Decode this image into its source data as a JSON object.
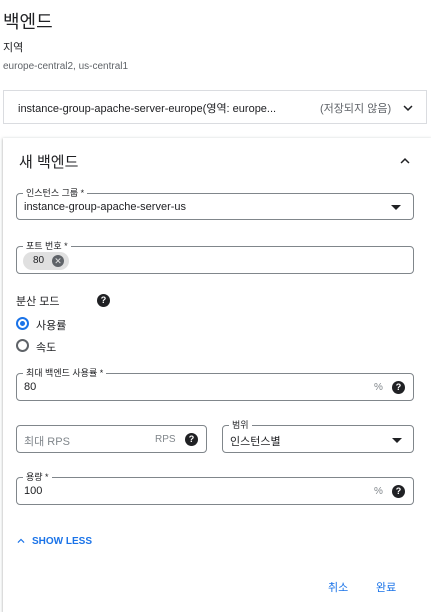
{
  "section": {
    "title": "백엔드",
    "region_label": "지역",
    "region_value": "europe-central2, us-central1"
  },
  "collapsed_backend": {
    "name": "instance-group-apache-server-europe(영역: europe...",
    "status": "(저장되지 않음)",
    "icon": "chevron-down-icon"
  },
  "new_backend": {
    "title": "새 백엔드",
    "icon": "chevron-up-icon",
    "instance_group": {
      "label": "인스턴스 그룹 *",
      "value": "instance-group-apache-server-us"
    },
    "port_numbers": {
      "label": "포트 번호 *",
      "chip_value": "80"
    },
    "balancing_mode": {
      "label": "분산 모드",
      "options": [
        {
          "label": "사용률",
          "selected": true
        },
        {
          "label": "속도",
          "selected": false
        }
      ]
    },
    "max_backend_utilization": {
      "label": "최대 백엔드 사용률 *",
      "value": "80",
      "suffix": "%"
    },
    "max_rps": {
      "placeholder": "최대 RPS",
      "suffix": "RPS"
    },
    "scope": {
      "label": "범위",
      "value": "인스턴스별"
    },
    "capacity": {
      "label": "용량 *",
      "value": "100",
      "suffix": "%"
    },
    "show_less": "SHOW LESS",
    "cancel": "취소",
    "done": "완료"
  },
  "colors": {
    "accent": "#1a73e8",
    "border": "#80868b",
    "text": "#202124",
    "muted": "#5f6368"
  }
}
